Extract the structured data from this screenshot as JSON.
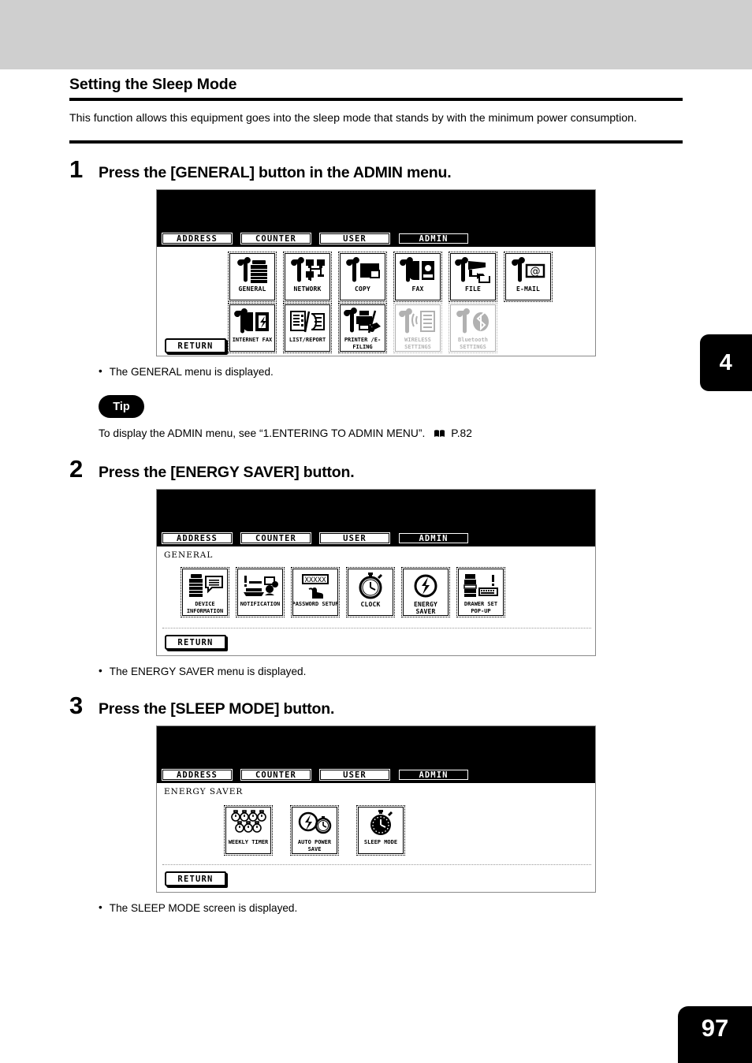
{
  "section": {
    "title": "Setting the Sleep Mode",
    "intro": "This function allows this equipment goes into the sleep mode that stands by with the minimum power consumption."
  },
  "chapter_tab": "4",
  "page_number": "97",
  "steps": [
    {
      "number": "1",
      "heading": "Press the [GENERAL] button in the ADMIN menu.",
      "note_bullet": "•",
      "note": "The GENERAL menu is displayed."
    },
    {
      "number": "2",
      "heading": "Press the [ENERGY SAVER] button.",
      "note_bullet": "•",
      "note": "The ENERGY SAVER menu is displayed."
    },
    {
      "number": "3",
      "heading": "Press the [SLEEP MODE] button.",
      "note_bullet": "•",
      "note": "The SLEEP MODE screen is displayed."
    }
  ],
  "tip": {
    "badge": "Tip",
    "text": "To display the ADMIN menu, see “1.ENTERING TO ADMIN MENU”.",
    "reference": "P.82",
    "icon": "book-icon"
  },
  "lcd_panels": [
    {
      "id": "admin-menu",
      "tabs": [
        {
          "label": "ADDRESS",
          "selected": false
        },
        {
          "label": "COUNTER",
          "selected": false
        },
        {
          "label": "USER",
          "selected": false
        },
        {
          "label": "ADMIN",
          "selected": true
        }
      ],
      "breadcrumb": "",
      "return_label": "RETURN",
      "rows": [
        [
          {
            "label": "GENERAL",
            "icon": "wrench-copier-icon",
            "disabled": false
          },
          {
            "label": "NETWORK",
            "icon": "wrench-network-icon",
            "disabled": false
          },
          {
            "label": "COPY",
            "icon": "wrench-page-icon",
            "disabled": false
          },
          {
            "label": "FAX",
            "icon": "wrench-fax-icon",
            "disabled": false
          },
          {
            "label": "FILE",
            "icon": "wrench-folder-icon",
            "disabled": false
          },
          {
            "label": "E-MAIL",
            "icon": "wrench-at-icon",
            "disabled": false
          }
        ],
        [
          {
            "label": "INTERNET FAX",
            "icon": "wrench-internetfax-icon",
            "disabled": false
          },
          {
            "label": "LIST/REPORT",
            "icon": "list-report-icon",
            "disabled": false
          },
          {
            "label": "PRINTER /E-FILING",
            "icon": "wrench-printer-icon",
            "disabled": false
          },
          {
            "label": "WIRELESS SETTINGS",
            "icon": "wrench-wireless-icon",
            "disabled": true
          },
          {
            "label": "Bluetooth SETTINGS",
            "icon": "wrench-bluetooth-icon",
            "disabled": true
          }
        ]
      ]
    },
    {
      "id": "general-menu",
      "tabs": [
        {
          "label": "ADDRESS",
          "selected": false
        },
        {
          "label": "COUNTER",
          "selected": false
        },
        {
          "label": "USER",
          "selected": false
        },
        {
          "label": "ADMIN",
          "selected": true
        }
      ],
      "breadcrumb": "GENERAL",
      "return_label": "RETURN",
      "rows": [
        [
          {
            "label": "DEVICE INFORMATION",
            "icon": "device-info-icon",
            "disabled": false
          },
          {
            "label": "NOTIFICATION",
            "icon": "notification-icon",
            "disabled": false
          },
          {
            "label": "PASSWORD SETUP",
            "icon": "password-setup-icon",
            "disabled": false
          },
          {
            "label": "CLOCK",
            "icon": "clock-icon",
            "disabled": false
          },
          {
            "label": "ENERGY SAVER",
            "icon": "energy-saver-icon",
            "disabled": false
          },
          {
            "label": "DRAWER SET POP-UP",
            "icon": "drawer-popup-icon",
            "disabled": false
          }
        ]
      ]
    },
    {
      "id": "energy-saver-menu",
      "tabs": [
        {
          "label": "ADDRESS",
          "selected": false
        },
        {
          "label": "COUNTER",
          "selected": false
        },
        {
          "label": "USER",
          "selected": false
        },
        {
          "label": "ADMIN",
          "selected": true
        }
      ],
      "breadcrumb": "ENERGY SAVER",
      "return_label": "RETURN",
      "rows": [
        [
          {
            "label": "WEEKLY TIMER",
            "icon": "weekly-timer-icon",
            "disabled": false
          },
          {
            "label": "AUTO POWER SAVE",
            "icon": "auto-power-save-icon",
            "disabled": false
          },
          {
            "label": "SLEEP MODE",
            "icon": "sleep-mode-icon",
            "disabled": false
          }
        ]
      ]
    }
  ]
}
